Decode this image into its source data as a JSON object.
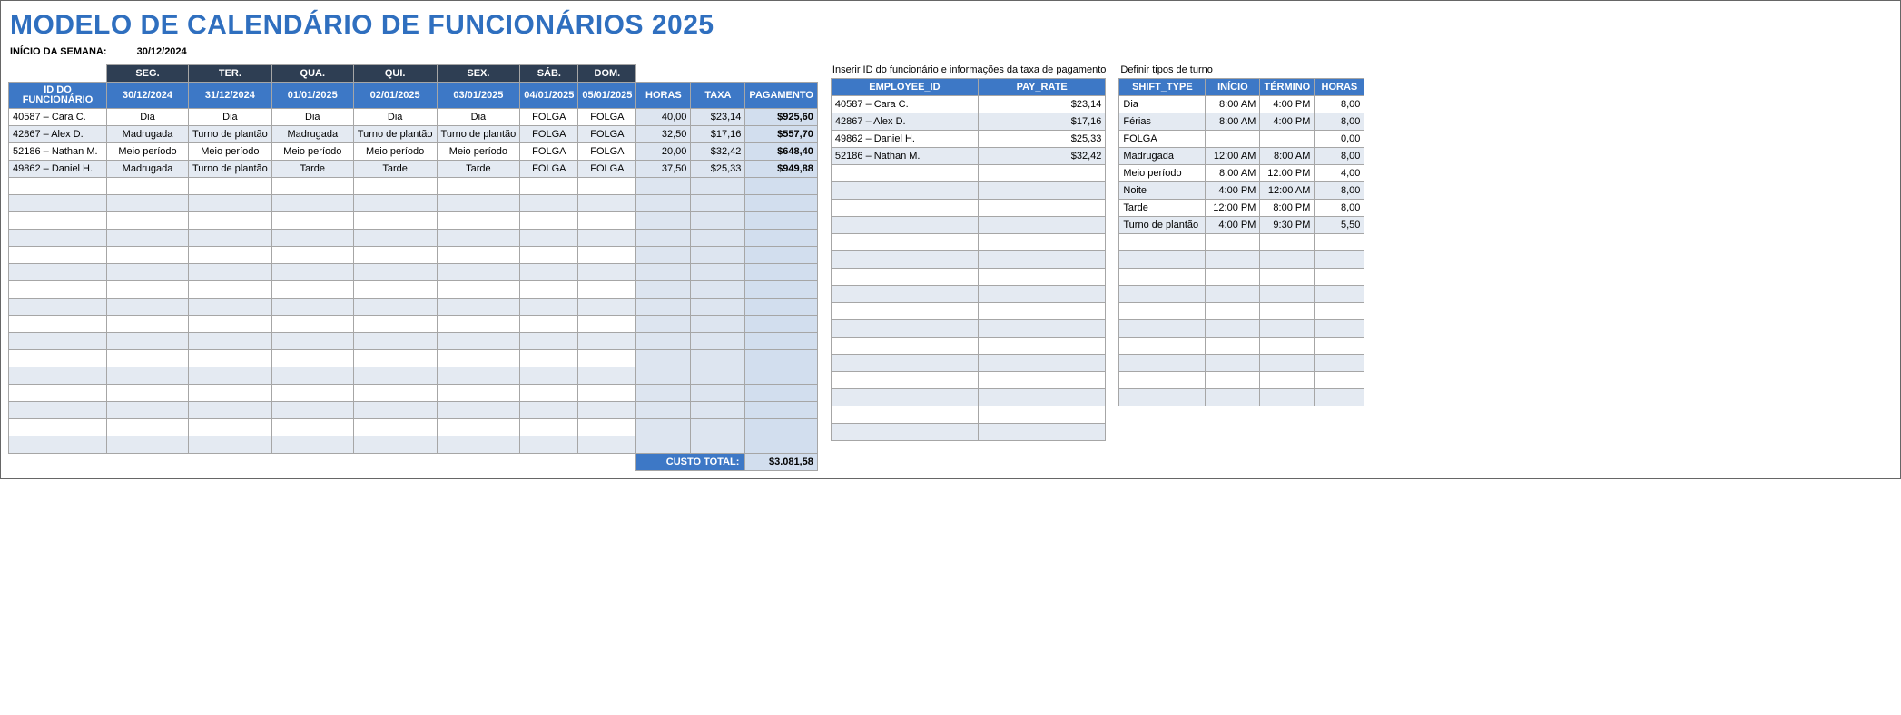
{
  "title": "MODELO DE CALENDÁRIO DE FUNCIONÁRIOS 2025",
  "week_start_label": "INÍCIO DA SEMANA:",
  "week_start_value": "30/12/2024",
  "schedule": {
    "day_headers": [
      "SEG.",
      "TER.",
      "QUA.",
      "QUI.",
      "SEX.",
      "SÁB.",
      "DOM."
    ],
    "id_header": "ID DO FUNCIONÁRIO",
    "date_headers": [
      "30/12/2024",
      "31/12/2024",
      "01/01/2025",
      "02/01/2025",
      "03/01/2025",
      "04/01/2025",
      "05/01/2025"
    ],
    "hours_header": "HORAS",
    "rate_header": "TAXA",
    "pay_header": "PAGAMENTO",
    "rows": [
      {
        "id": "40587 – Cara C.",
        "days": [
          "Dia",
          "Dia",
          "Dia",
          "Dia",
          "Dia",
          "FOLGA",
          "FOLGA"
        ],
        "hours": "40,00",
        "rate": "$23,14",
        "pay": "$925,60"
      },
      {
        "id": "42867 – Alex D.",
        "days": [
          "Madrugada",
          "Turno de plantão",
          "Madrugada",
          "Turno de plantão",
          "Turno de plantão",
          "FOLGA",
          "FOLGA"
        ],
        "hours": "32,50",
        "rate": "$17,16",
        "pay": "$557,70"
      },
      {
        "id": "52186 – Nathan M.",
        "days": [
          "Meio período",
          "Meio período",
          "Meio período",
          "Meio período",
          "Meio período",
          "FOLGA",
          "FOLGA"
        ],
        "hours": "20,00",
        "rate": "$32,42",
        "pay": "$648,40"
      },
      {
        "id": "49862 – Daniel H.",
        "days": [
          "Madrugada",
          "Turno de plantão",
          "Tarde",
          "Tarde",
          "Tarde",
          "FOLGA",
          "FOLGA"
        ],
        "hours": "37,50",
        "rate": "$25,33",
        "pay": "$949,88"
      }
    ],
    "empty_rows": 16,
    "total_label": "CUSTO TOTAL:",
    "total_value": "$3.081,58"
  },
  "employees": {
    "caption": "Inserir ID do funcionário e informações da taxa de pagamento",
    "h_id": "EMPLOYEE_ID",
    "h_rate": "PAY_RATE",
    "rows": [
      {
        "id": "40587 – Cara C.",
        "rate": "$23,14"
      },
      {
        "id": "42867 – Alex D.",
        "rate": "$17,16"
      },
      {
        "id": "49862 – Daniel H.",
        "rate": "$25,33"
      },
      {
        "id": "52186 – Nathan M.",
        "rate": "$32,42"
      }
    ],
    "empty_rows": 16
  },
  "shifts": {
    "caption": "Definir tipos de turno",
    "h_type": "SHIFT_TYPE",
    "h_start": "INÍCIO",
    "h_end": "TÉRMINO",
    "h_hours": "HORAS",
    "rows": [
      {
        "type": "Dia",
        "start": "8:00 AM",
        "end": "4:00 PM",
        "hours": "8,00"
      },
      {
        "type": "Férias",
        "start": "8:00 AM",
        "end": "4:00 PM",
        "hours": "8,00"
      },
      {
        "type": "FOLGA",
        "start": "",
        "end": "",
        "hours": "0,00"
      },
      {
        "type": "Madrugada",
        "start": "12:00 AM",
        "end": "8:00 AM",
        "hours": "8,00"
      },
      {
        "type": "Meio período",
        "start": "8:00 AM",
        "end": "12:00 PM",
        "hours": "4,00"
      },
      {
        "type": "Noite",
        "start": "4:00 PM",
        "end": "12:00 AM",
        "hours": "8,00"
      },
      {
        "type": "Tarde",
        "start": "12:00 PM",
        "end": "8:00 PM",
        "hours": "8,00"
      },
      {
        "type": "Turno de plantão",
        "start": "4:00 PM",
        "end": "9:30 PM",
        "hours": "5,50"
      }
    ],
    "empty_rows": 10
  }
}
